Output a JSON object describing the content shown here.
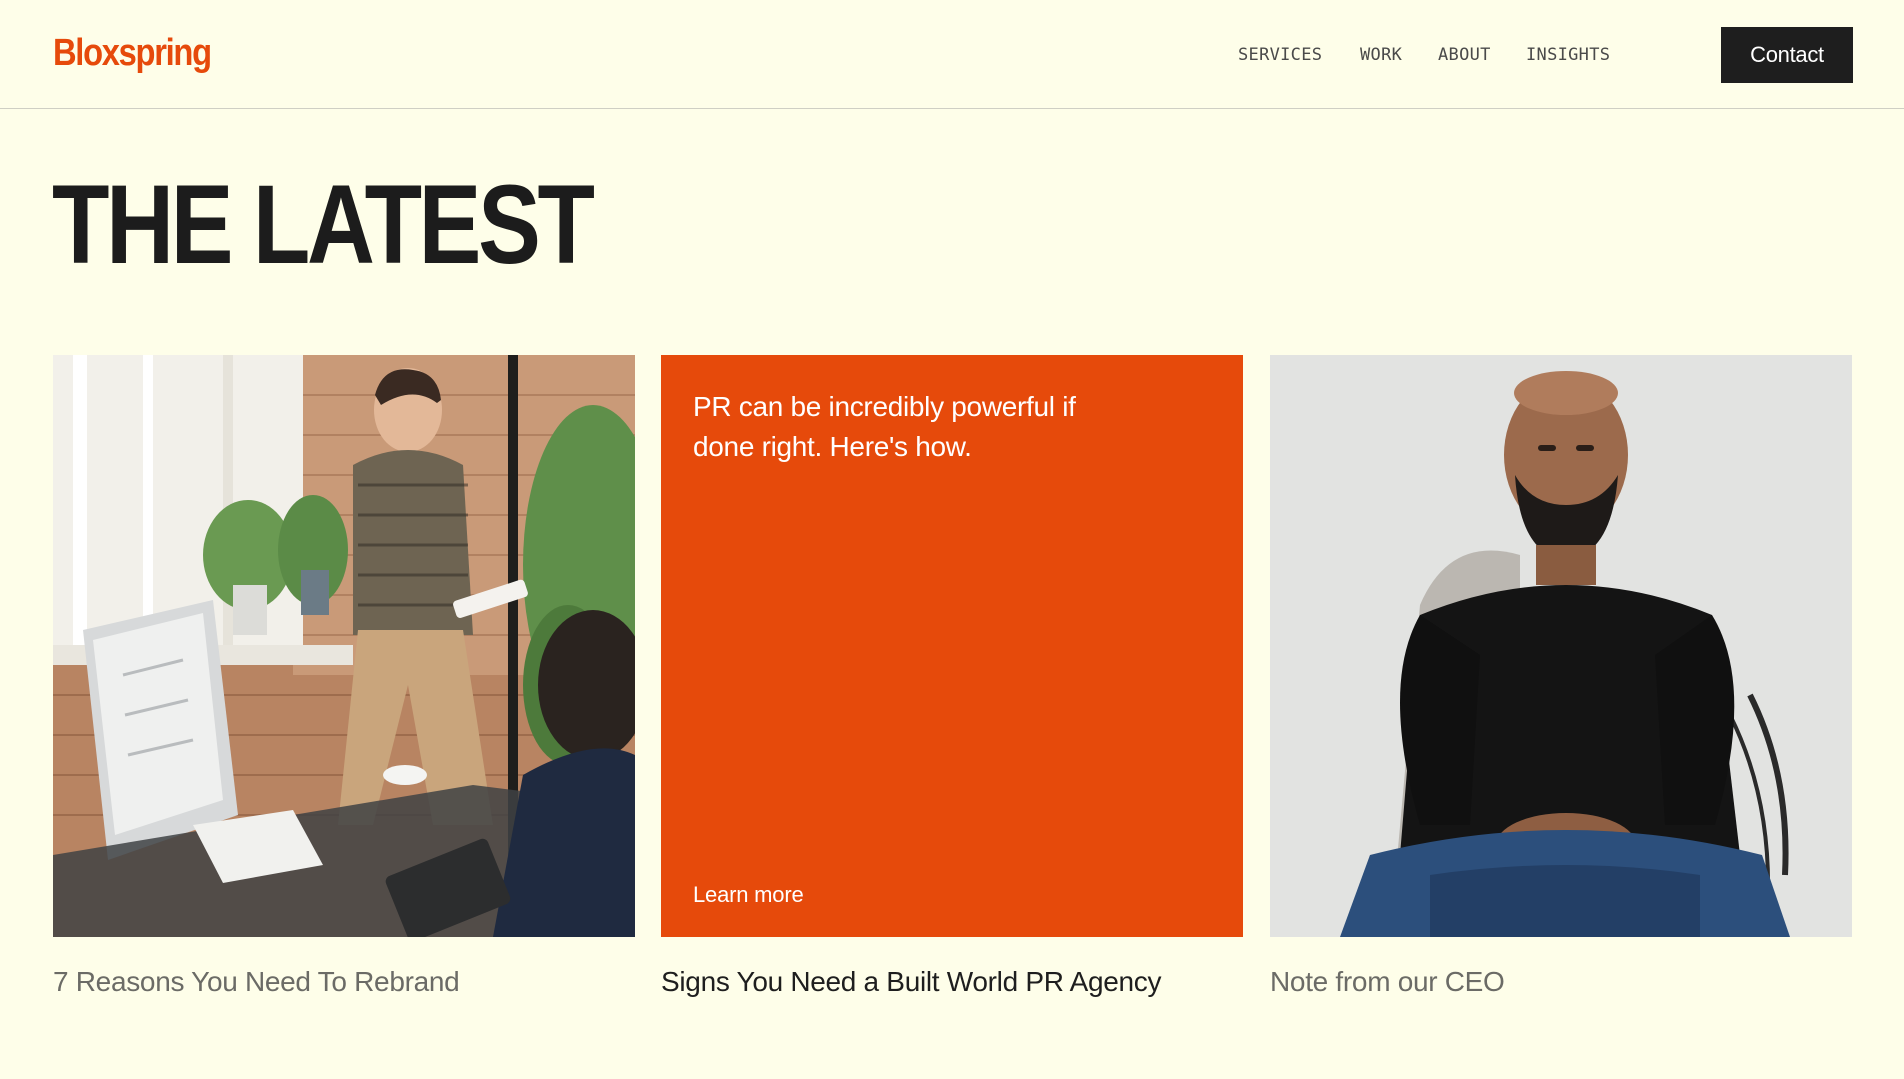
{
  "brand": {
    "logo_text": "Bloxspring",
    "accent_color": "#e64a0b"
  },
  "nav": {
    "items": [
      {
        "label": "SERVICES"
      },
      {
        "label": "WORK"
      },
      {
        "label": "ABOUT"
      },
      {
        "label": "INSIGHTS"
      }
    ],
    "contact_label": "Contact"
  },
  "main": {
    "title": "THE LATEST",
    "cards": [
      {
        "title": "7 Reasons You Need To Rebrand",
        "image": "office-meeting-photo",
        "title_color": "#6b6b66"
      },
      {
        "promo_text": "PR can be incredibly powerful if done right. Here's how.",
        "link_label": "Learn more",
        "title": "Signs You Need a Built World PR Agency",
        "background": "#e64a0b",
        "title_color": "#1e1e1e"
      },
      {
        "title": "Note from our CEO",
        "image": "ceo-portrait-photo",
        "title_color": "#6b6b66"
      }
    ]
  }
}
